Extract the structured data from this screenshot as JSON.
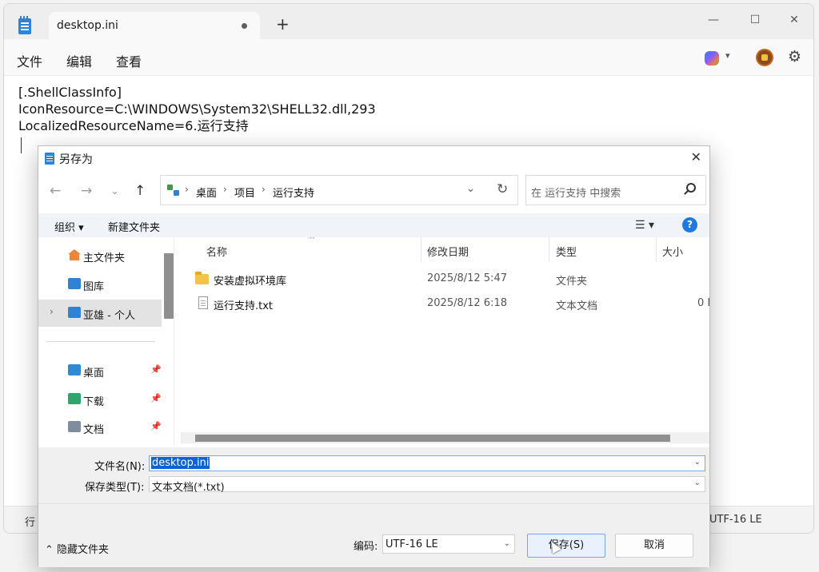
{
  "notepad": {
    "tab_title": "desktop.ini",
    "new_tab": "+",
    "window_controls": {
      "minimize": "—",
      "maximize": "☐",
      "close": "✕"
    },
    "menu": [
      "文件",
      "编辑",
      "查看"
    ],
    "toolbar_icons": [
      "copilot-icon",
      "chevron-down-icon",
      "avatar",
      "gear-icon"
    ],
    "content_lines": [
      "[.ShellClassInfo]",
      "IconResource=C:\\WINDOWS\\System32\\SHELL32.dll,293",
      "LocalizedResourceName=6.运行支持"
    ],
    "status_left": "行",
    "status_encoding": "UTF-16 LE"
  },
  "dialog": {
    "title": "另存为",
    "breadcrumb": [
      "桌面",
      "项目",
      "运行支持"
    ],
    "search_placeholder": "在 运行支持 中搜索",
    "commands": {
      "organize": "组织 ▾",
      "new_folder": "新建文件夹",
      "view": "☰ ▾",
      "help": "?"
    },
    "nav_items": [
      {
        "label": "主文件夹",
        "icon": "home-icon",
        "color": "#e9873a"
      },
      {
        "label": "图库",
        "icon": "gallery-icon",
        "color": "#2f83d6"
      },
      {
        "label": "亚雄 - 个人",
        "icon": "onedrive-folder-icon",
        "color": "#2f83d6",
        "selected": true
      },
      {
        "label": "桌面",
        "icon": "desktop-folder-icon",
        "color": "#2f8ad6",
        "pinned": true
      },
      {
        "label": "下载",
        "icon": "downloads-folder-icon",
        "color": "#2fa56b",
        "pinned": true
      },
      {
        "label": "文档",
        "icon": "documents-folder-icon",
        "color": "#7f8d9c",
        "pinned": true
      }
    ],
    "columns": {
      "name": "名称",
      "date": "修改日期",
      "type": "类型",
      "size": "大小"
    },
    "files": [
      {
        "name": "安装虚拟环境库",
        "date": "2025/8/12 5:47",
        "type": "文件夹",
        "size": "",
        "icon": "folder-icon"
      },
      {
        "name": "运行支持.txt",
        "date": "2025/8/12 6:18",
        "type": "文本文档",
        "size": "0 I",
        "icon": "text-file-icon"
      }
    ],
    "filename_label": "文件名(N):",
    "filename_value": "desktop.ini",
    "filetype_label": "保存类型(T):",
    "filetype_value": "文本文档(*.txt)",
    "hide_folders": "⌃ 隐藏文件夹",
    "encoding_label": "编码:",
    "encoding_value": "UTF-16 LE",
    "save_button": "保存(S)",
    "cancel_button": "取消"
  }
}
